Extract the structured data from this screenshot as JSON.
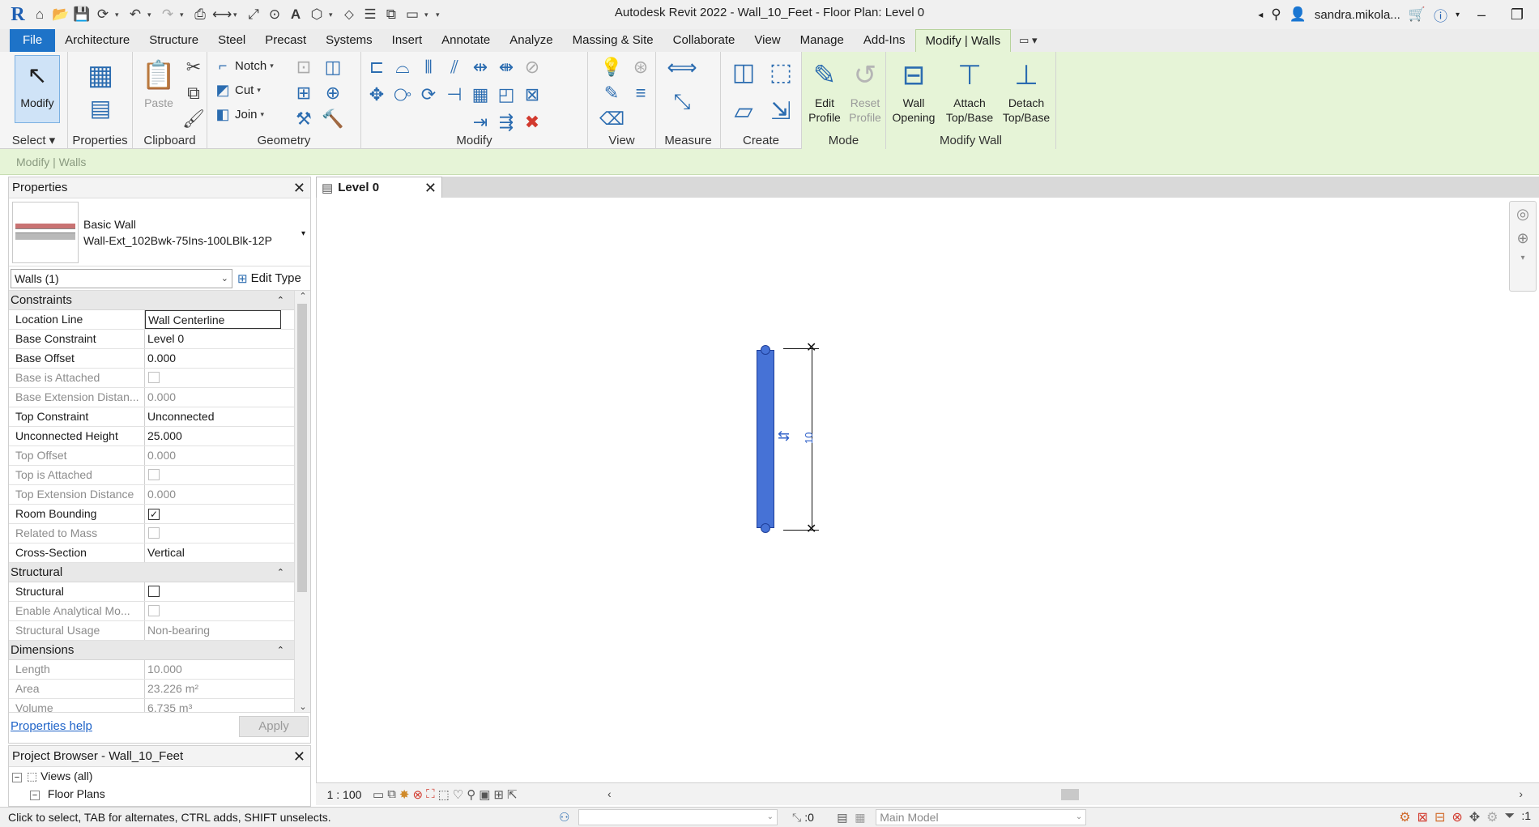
{
  "window": {
    "title": "Autodesk Revit 2022 - Wall_10_Feet - Floor Plan: Level 0",
    "user": "sandra.mikola...",
    "app_logo": "R"
  },
  "ribbon_tabs": [
    "Architecture",
    "Structure",
    "Steel",
    "Precast",
    "Systems",
    "Insert",
    "Annotate",
    "Analyze",
    "Massing & Site",
    "Collaborate",
    "View",
    "Manage",
    "Add-Ins"
  ],
  "file_tab": "File",
  "active_tab": "Modify | Walls",
  "ribbon": {
    "modify_label": "Modify",
    "select_panel": "Select",
    "properties_panel": "Properties",
    "clipboard_panel": "Clipboard",
    "paste_label": "Paste",
    "geometry_panel": "Geometry",
    "notch_label": "Notch",
    "cut_label": "Cut",
    "join_label": "Join",
    "modify_panel": "Modify",
    "view_panel": "View",
    "measure_panel": "Measure",
    "create_panel": "Create",
    "mode_panel": "Mode",
    "edit_profile": "Edit Profile",
    "reset_profile": "Reset Profile",
    "modify_wall_panel": "Modify Wall",
    "wall_opening": "Wall Opening",
    "attach_top_base": "Attach Top/Base",
    "detach_top_base": "Detach Top/Base"
  },
  "options_bar": {
    "context": "Modify | Walls"
  },
  "properties": {
    "title": "Properties",
    "type_family": "Basic Wall",
    "type_name": "Wall-Ext_102Bwk-75Ins-100LBlk-12P",
    "filter": "Walls (1)",
    "edit_type": "Edit Type",
    "groups": {
      "constraints": "Constraints",
      "structural": "Structural",
      "dimensions": "Dimensions"
    },
    "rows": {
      "location_line": {
        "label": "Location Line",
        "value": "Wall Centerline"
      },
      "base_constraint": {
        "label": "Base Constraint",
        "value": "Level 0"
      },
      "base_offset": {
        "label": "Base Offset",
        "value": "0.000"
      },
      "base_attached": {
        "label": "Base is Attached"
      },
      "base_ext": {
        "label": "Base Extension Distan...",
        "value": "0.000"
      },
      "top_constraint": {
        "label": "Top Constraint",
        "value": "Unconnected"
      },
      "unconnected_height": {
        "label": "Unconnected Height",
        "value": "25.000"
      },
      "top_offset": {
        "label": "Top Offset",
        "value": "0.000"
      },
      "top_attached": {
        "label": "Top is Attached"
      },
      "top_ext": {
        "label": "Top Extension Distance",
        "value": "0.000"
      },
      "room_bounding": {
        "label": "Room Bounding",
        "checked": true
      },
      "related_mass": {
        "label": "Related to Mass"
      },
      "cross_section": {
        "label": "Cross-Section",
        "value": "Vertical"
      },
      "structural": {
        "label": "Structural",
        "checked": false
      },
      "enable_analytical": {
        "label": "Enable Analytical Mo..."
      },
      "structural_usage": {
        "label": "Structural Usage",
        "value": "Non-bearing"
      },
      "length": {
        "label": "Length",
        "value": "10.000"
      },
      "area": {
        "label": "Area",
        "value": "23.226 m²"
      },
      "volume": {
        "label": "Volume",
        "value": "6.735 m³"
      }
    },
    "help_link": "Properties help",
    "apply": "Apply"
  },
  "project_browser": {
    "title": "Project Browser - Wall_10_Feet",
    "views_all": "Views (all)",
    "floor_plans": "Floor Plans"
  },
  "view_tab": {
    "label": "Level 0"
  },
  "canvas": {
    "dim_value": "10"
  },
  "view_control": {
    "scale": "1 : 100"
  },
  "status": {
    "hint": "Click to select, TAB for alternates, CTRL adds, SHIFT unselects.",
    "zero": ":0",
    "model": "Main Model",
    "filter_count": ":1"
  },
  "colors": {
    "accent": "#1e73c8",
    "context_tab": "#e6f4d7",
    "wall": "#4672d6"
  }
}
